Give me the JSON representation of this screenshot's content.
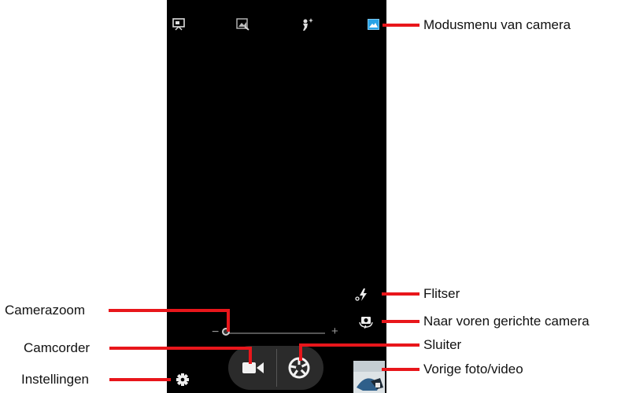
{
  "callouts": {
    "mode_menu": "Modusmenu van camera",
    "flash": "Flitser",
    "front_camera": "Naar voren gerichte camera",
    "shutter": "Sluiter",
    "previous": "Vorige foto/video",
    "zoom": "Camerazoom",
    "camcorder": "Camcorder",
    "settings": "Instellingen"
  },
  "zoom": {
    "minus": "−",
    "plus": "+",
    "level": 0.0
  },
  "colors": {
    "callout_line": "#e8161b",
    "active_mode": "#29a3e6",
    "viewfinder": "#000000"
  },
  "icons": [
    "presentation-mode-icon",
    "scene-mode-icon",
    "portrait-sparkle-mode-icon",
    "landscape-mode-icon",
    "flash-icon",
    "camera-switch-icon",
    "settings-gear-icon",
    "video-camera-icon",
    "shutter-aperture-icon"
  ]
}
